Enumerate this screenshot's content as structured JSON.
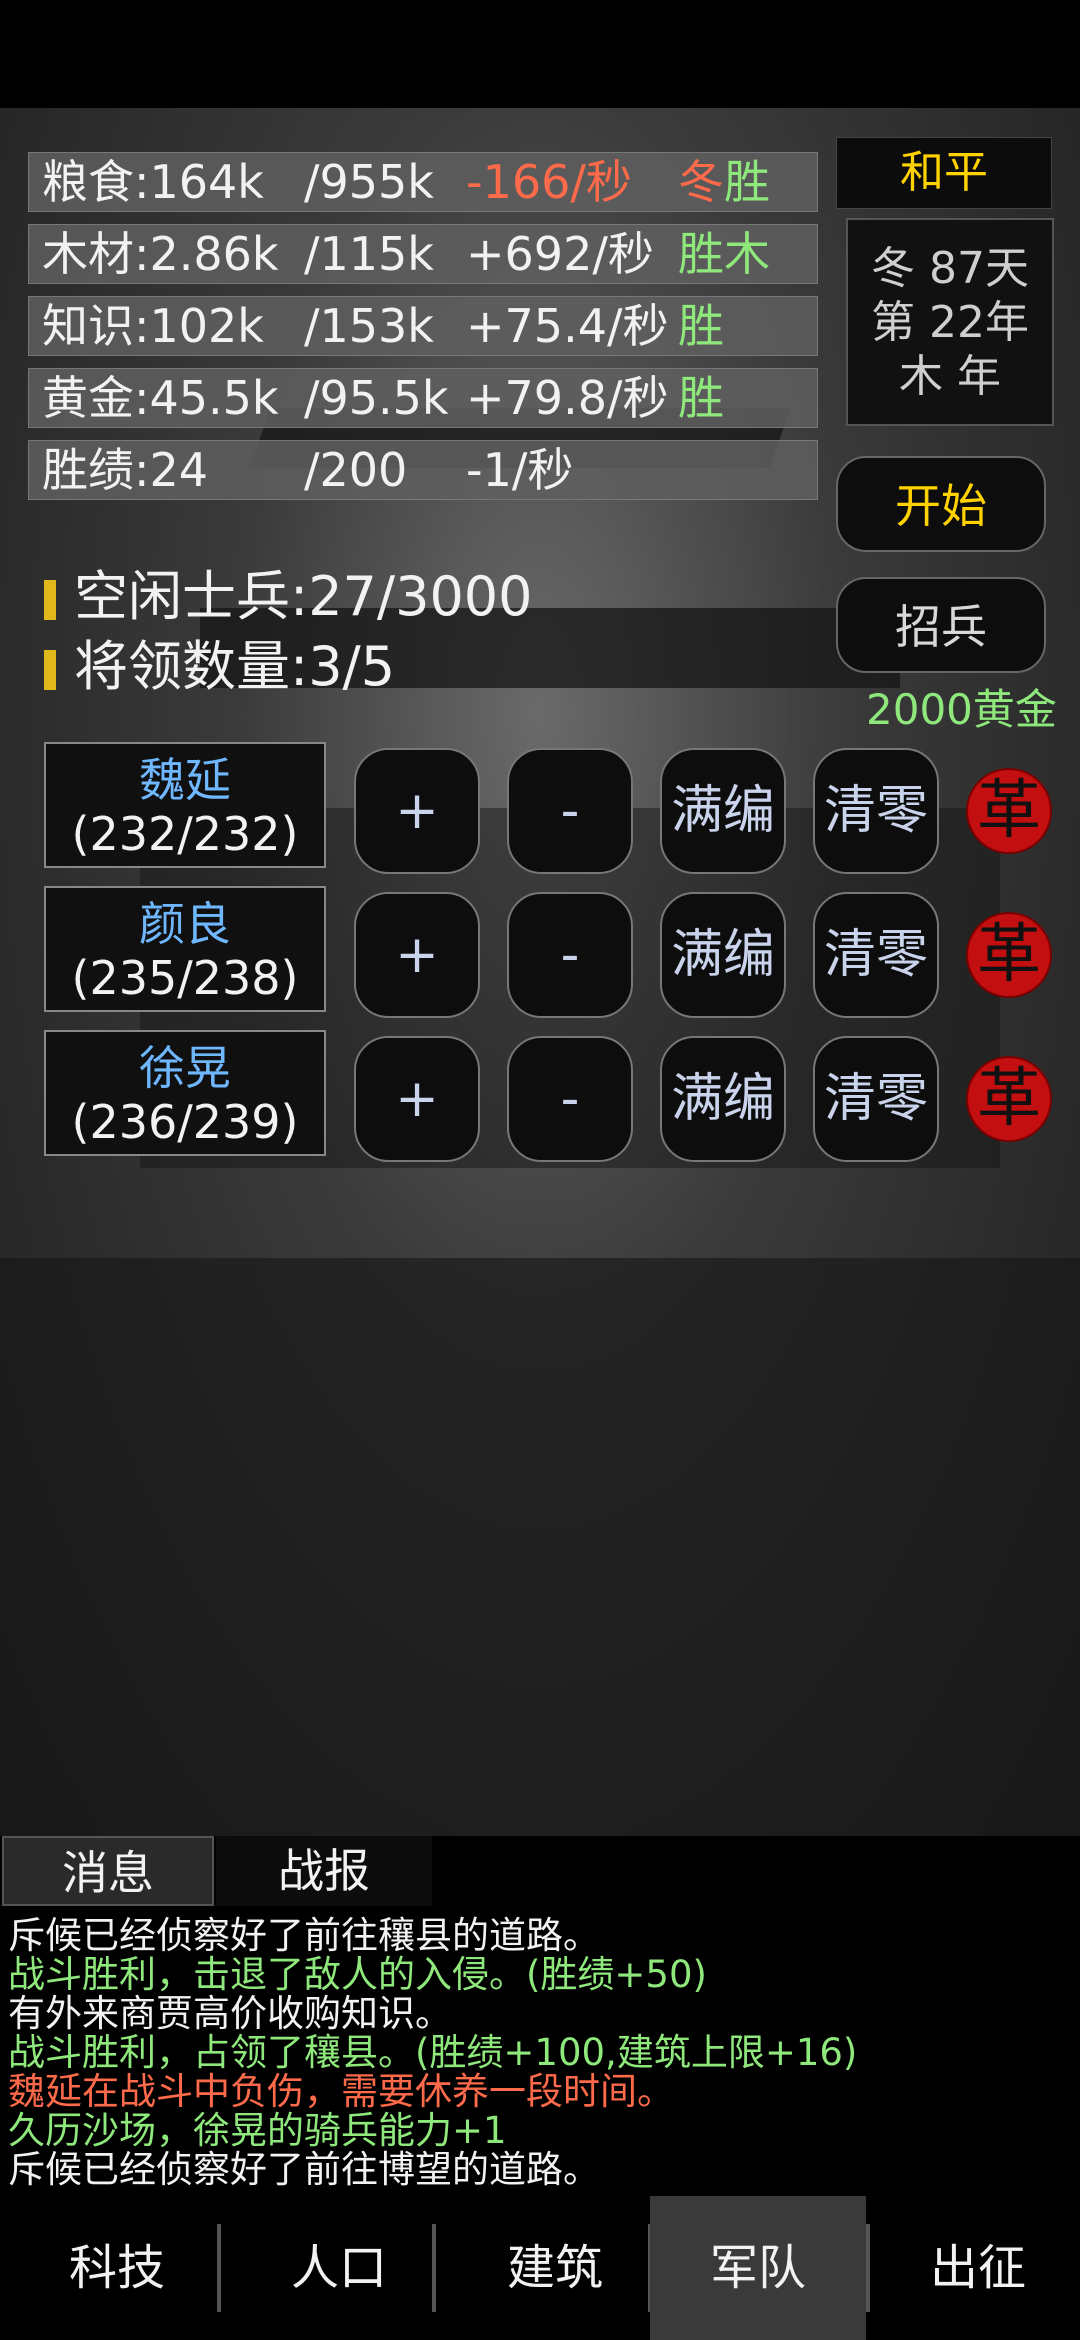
{
  "resources": [
    {
      "name": "粮食:164k",
      "max": "/955k",
      "rate": "-166/秒",
      "rate_type": "neg",
      "tag_a": "冬",
      "tag_b": "胜"
    },
    {
      "name": "木材:2.86k",
      "max": "/115k",
      "rate": "+692/秒",
      "rate_type": "pos",
      "tag_a": "",
      "tag_b": "胜木"
    },
    {
      "name": "知识:102k",
      "max": "/153k",
      "rate": "+75.4/秒",
      "rate_type": "pos",
      "tag_a": "",
      "tag_b": "胜"
    },
    {
      "name": "黄金:45.5k",
      "max": "/95.5k",
      "rate": "+79.8/秒",
      "rate_type": "pos",
      "tag_a": "",
      "tag_b": "胜"
    },
    {
      "name": "胜绩:24",
      "max": "/200",
      "rate": "-1/秒",
      "rate_type": "pos",
      "tag_a": "",
      "tag_b": ""
    }
  ],
  "status": {
    "peace": "和平",
    "date_line1": "冬 87天",
    "date_line2": "第 22年",
    "date_line3": "木 年"
  },
  "buttons": {
    "start": "开始",
    "recruit": "招兵",
    "recruit_cost": "2000黄金"
  },
  "stats": {
    "idle_soldiers": "空闲士兵:27/3000",
    "general_count": "将领数量:3/5"
  },
  "generals": [
    {
      "name": "魏延",
      "count": "(232/232)"
    },
    {
      "name": "颜良",
      "count": "(235/238)"
    },
    {
      "name": "徐晃",
      "count": "(236/239)"
    }
  ],
  "general_actions": {
    "plus": "+",
    "minus": "-",
    "full": "满编",
    "clear": "清零",
    "dismiss": "革"
  },
  "tabs": {
    "messages": "消息",
    "battle_report": "战报"
  },
  "log": [
    {
      "text": "斥候已经侦察好了前往穰县的道路。",
      "color": "white"
    },
    {
      "text": "战斗胜利，击退了敌人的入侵。(胜绩+50)",
      "color": "green"
    },
    {
      "text": "有外来商贾高价收购知识。",
      "color": "white"
    },
    {
      "text": "战斗胜利，占领了穰县。(胜绩+100,建筑上限+16)",
      "color": "green"
    },
    {
      "text": "魏延在战斗中负伤，需要休养一段时间。",
      "color": "red"
    },
    {
      "text": "久历沙场，徐晃的骑兵能力+1",
      "color": "green"
    },
    {
      "text": "斥候已经侦察好了前往博望的道路。",
      "color": "white"
    }
  ],
  "nav": {
    "tech": "科技",
    "population": "人口",
    "buildings": "建筑",
    "army": "军队",
    "expedition": "出征",
    "active": "army"
  },
  "colors": {
    "gold": "#ffd200",
    "green": "#8fe87c",
    "red": "#ff6a4a",
    "blue": "#6fb8ff"
  }
}
